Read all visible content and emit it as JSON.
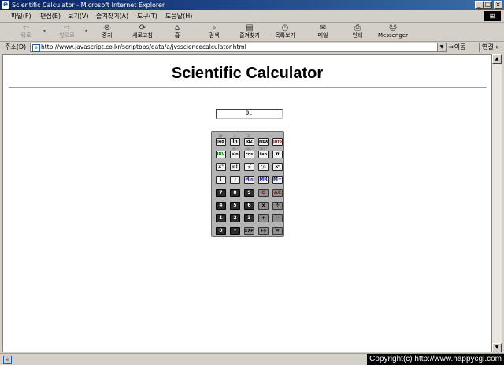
{
  "window": {
    "title": "Scientific Calculator - Microsoft Internet Explorer",
    "controls": [
      "_",
      "□",
      "×"
    ]
  },
  "menu": [
    "파일(F)",
    "편집(E)",
    "보기(V)",
    "즐겨찾기(A)",
    "도구(T)",
    "도움말(H)"
  ],
  "toolbar": {
    "back": "뒤로",
    "forward": "앞으로",
    "stop": "중지",
    "refresh": "새로고침",
    "home": "홈",
    "search": "검색",
    "favorites": "즐겨찾기",
    "history": "목록보기",
    "mail": "메일",
    "print": "인쇄",
    "messenger": "Messenger"
  },
  "address": {
    "label": "주소(D)",
    "url": "http://www.javascript.co.kr/scriptbbs/data/a/jvssciencecalculator.html",
    "go": "이동",
    "links": "연결 »"
  },
  "page": {
    "title": "Scientific Calculator",
    "display_value": "0."
  },
  "calculator": {
    "rows": [
      [
        {
          "label": "log",
          "sub": "10ˣ"
        },
        {
          "label": "ln",
          "sub": "eˣ"
        },
        {
          "label": "lg2",
          "sub": "2ˣ"
        },
        {
          "label": "HEX"
        },
        {
          "label": "info",
          "style": "red-text"
        }
      ],
      [
        {
          "label": "INV",
          "style": "green"
        },
        {
          "label": "sin",
          "sub": "sin⁻¹"
        },
        {
          "label": "cos",
          "sub": "cos⁻¹"
        },
        {
          "label": "tan",
          "sub": "tan⁻¹"
        },
        {
          "label": "π"
        }
      ],
      [
        {
          "label": "x²"
        },
        {
          "label": "n!"
        },
        {
          "label": "√"
        },
        {
          "label": "¹/ₓ"
        },
        {
          "label": "xʸ"
        }
      ],
      [
        {
          "label": "("
        },
        {
          "label": ")"
        },
        {
          "label": "Min",
          "style": "blue"
        },
        {
          "label": "MR",
          "style": "blue"
        },
        {
          "label": "M+",
          "style": "blue"
        }
      ],
      [
        {
          "label": "7"
        },
        {
          "label": "8"
        },
        {
          "label": "9"
        },
        {
          "label": "C"
        },
        {
          "label": "AC"
        }
      ],
      [
        {
          "label": "4"
        },
        {
          "label": "5"
        },
        {
          "label": "6"
        },
        {
          "label": "x"
        },
        {
          "label": "÷"
        }
      ],
      [
        {
          "label": "1"
        },
        {
          "label": "2"
        },
        {
          "label": "3"
        },
        {
          "label": "+"
        },
        {
          "label": "−"
        }
      ],
      [
        {
          "label": "0"
        },
        {
          "label": "•"
        },
        {
          "label": "EXP"
        },
        {
          "label": "+/-"
        },
        {
          "label": "="
        }
      ]
    ]
  },
  "status": {
    "copyright": "Copyright(c) http://www.happycgi.com"
  }
}
